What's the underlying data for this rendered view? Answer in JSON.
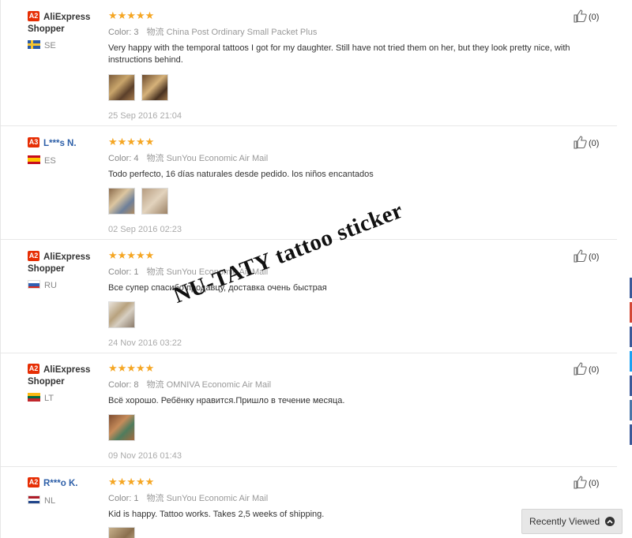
{
  "reviews": [
    {
      "badge": "A2",
      "name_line1": "AliExpress",
      "name_line2": "Shopper",
      "country": "SE",
      "stars": "★★★★★",
      "color_label": "Color:",
      "color_value": "3",
      "shipping": "物流 China Post Ordinary Small Packet Plus",
      "text": "Very happy with the temporal tattoos I got for my daughter. Still have not tried them on her, but they look pretty nice, with instructions behind.",
      "date": "25 Sep 2016 21:04",
      "likes": "(0)"
    },
    {
      "badge": "A3",
      "name_line1": "L***s N.",
      "country": "ES",
      "stars": "★★★★★",
      "color_label": "Color:",
      "color_value": "4",
      "shipping": "物流 SunYou Economic Air Mail",
      "text": "Todo perfecto, 16 días naturales desde pedido. los niños encantados",
      "date": "02 Sep 2016 02:23",
      "likes": "(0)"
    },
    {
      "badge": "A2",
      "name_line1": "AliExpress",
      "name_line2": "Shopper",
      "country": "RU",
      "stars": "★★★★★",
      "color_label": "Color:",
      "color_value": "1",
      "shipping": "物流 SunYou Economic Air Mail",
      "text": "Все супер спасибо продавцу, доставка очень быстрая",
      "date": "24 Nov 2016 03:22",
      "likes": "(0)"
    },
    {
      "badge": "A2",
      "name_line1": "AliExpress",
      "name_line2": "Shopper",
      "country": "LT",
      "stars": "★★★★★",
      "color_label": "Color:",
      "color_value": "8",
      "shipping": "物流 OMNIVA Economic Air Mail",
      "text": "Всё хорошо. Ребёнку нравится.Пришло в течение месяца.",
      "date": "09 Nov 2016 01:43",
      "likes": "(0)"
    },
    {
      "badge": "A2",
      "name_line1": "R***o K.",
      "country": "NL",
      "stars": "★★★★★",
      "color_label": "Color:",
      "color_value": "1",
      "shipping": "物流 SunYou Economic Air Mail",
      "text": "Kid is happy. Tattoo works. Takes 2,5 weeks of shipping.",
      "likes": "(0)"
    }
  ],
  "watermark": "NU-TATY tattoo sticker",
  "recently_viewed": "Recently Viewed",
  "colors": {
    "star": "#f5a623",
    "badge": "#e62e04",
    "username_blue": "#2d5fa8"
  }
}
